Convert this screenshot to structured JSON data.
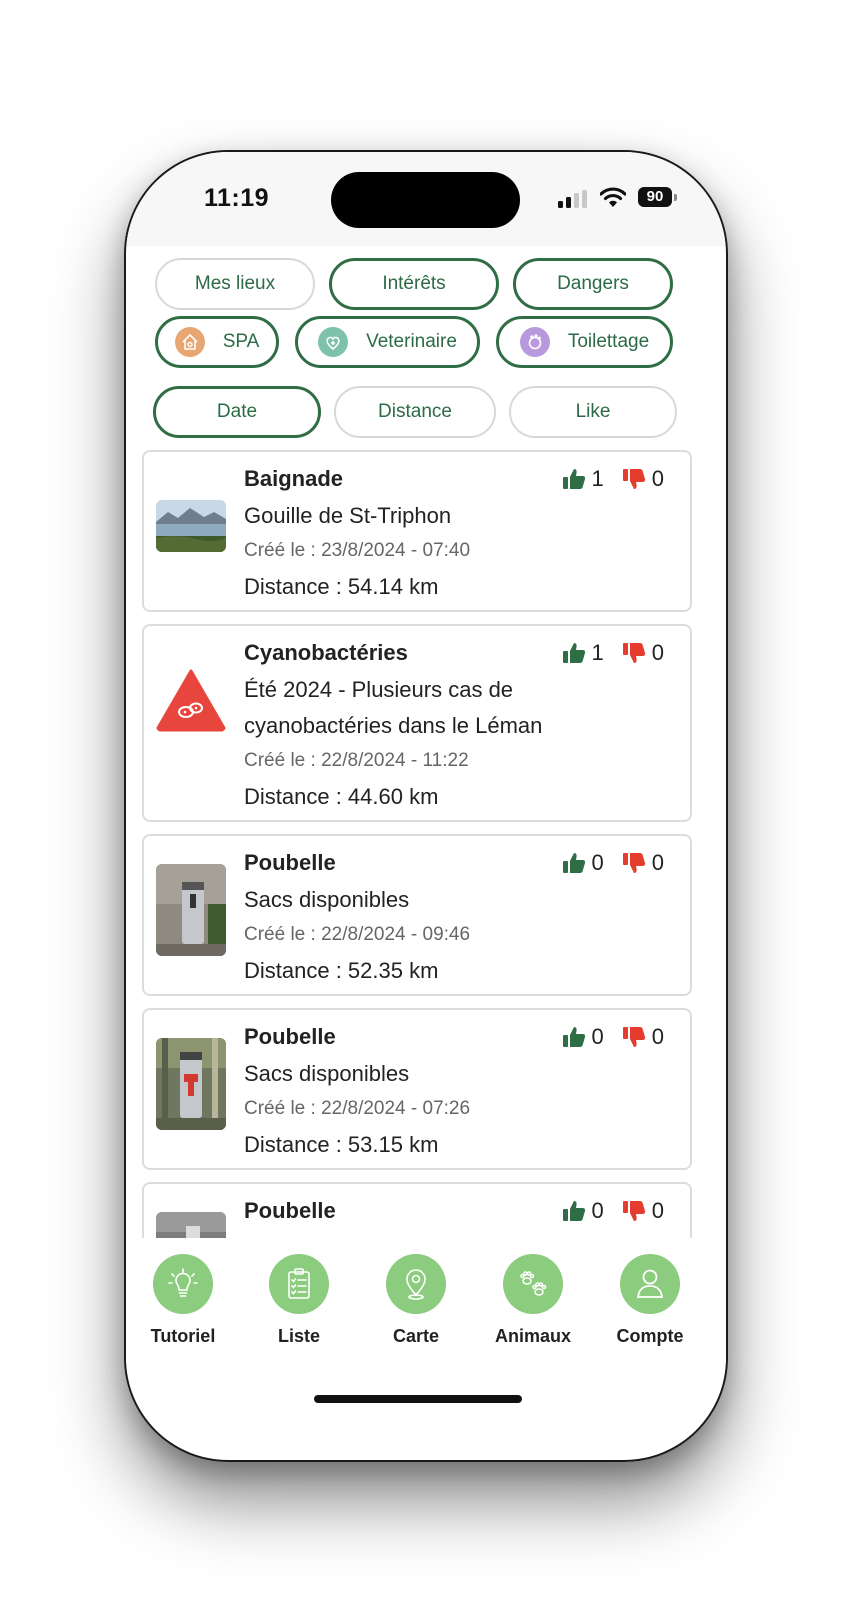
{
  "status_bar": {
    "time": "11:19",
    "battery": "90"
  },
  "filters": {
    "row1": [
      "Mes lieux",
      "Intérêts",
      "Dangers"
    ],
    "categories": [
      {
        "label": "SPA",
        "icon": "shelter-icon",
        "color": "#e8a672"
      },
      {
        "label": "Veterinaire",
        "icon": "vet-icon",
        "color": "#7dc2a9"
      },
      {
        "label": "Toilettage",
        "icon": "grooming-icon",
        "color": "#b999de"
      }
    ],
    "sort": [
      "Date",
      "Distance",
      "Like"
    ]
  },
  "places": [
    {
      "title": "Baignade",
      "description": "Gouille de St-Triphon",
      "date": "Créé le : 23/8/2024 - 07:40",
      "distance": "Distance : 54.14 km",
      "likes": "1",
      "dislikes": "0",
      "image": "lake-photo"
    },
    {
      "title": "Cyanobactéries",
      "description": "Été 2024 - Plusieurs cas de cyanobactéries dans le Léman",
      "date": "Créé le : 22/8/2024 - 11:22",
      "distance": "Distance : 44.60 km",
      "likes": "1",
      "dislikes": "0",
      "image": "danger-triangle-icon"
    },
    {
      "title": "Poubelle",
      "description": "Sacs disponibles",
      "date": "Créé le : 22/8/2024 - 09:46",
      "distance": "Distance : 52.35 km",
      "likes": "0",
      "dislikes": "0",
      "image": "bin-photo"
    },
    {
      "title": "Poubelle",
      "description": "Sacs disponibles",
      "date": "Créé le : 22/8/2024 - 07:26",
      "distance": "Distance : 53.15 km",
      "likes": "0",
      "dislikes": "0",
      "image": "bin-photo"
    },
    {
      "title": "Poubelle",
      "likes": "0",
      "dislikes": "0",
      "image": "bin-photo"
    }
  ],
  "tabbar": [
    {
      "label": "Tutoriel",
      "icon": "lightbulb-icon"
    },
    {
      "label": "Liste",
      "icon": "clipboard-list-icon"
    },
    {
      "label": "Carte",
      "icon": "map-pin-icon"
    },
    {
      "label": "Animaux",
      "icon": "paws-icon"
    },
    {
      "label": "Compte",
      "icon": "user-icon"
    }
  ],
  "colors": {
    "brand_green": "#2f6e45",
    "tab_green": "#8ccc7f",
    "like_green": "#2f6e45",
    "dislike_red": "#e43d30"
  }
}
